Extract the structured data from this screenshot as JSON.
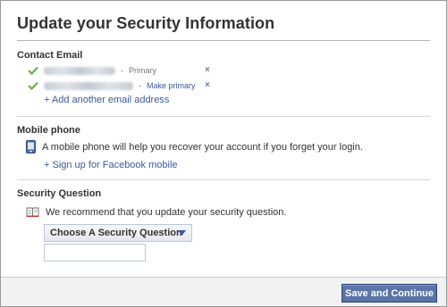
{
  "dialog": {
    "title": "Update your Security Information",
    "contact_email": {
      "heading": "Contact Email",
      "emails": [
        {
          "address_blurred": true,
          "separator": "-",
          "status": "Primary"
        },
        {
          "address_blurred": true,
          "separator": "-",
          "action": "Make primary"
        }
      ],
      "add_link": "+ Add another email address",
      "remove_symbol": "×"
    },
    "mobile_phone": {
      "heading": "Mobile phone",
      "info": "A mobile phone will help you recover your account if you forget your login.",
      "signup_link": "+ Sign up for Facebook mobile"
    },
    "security_question": {
      "heading": "Security Question",
      "info": "We recommend that you update your security question.",
      "dropdown_selected": "Choose A Security Question",
      "answer_value": ""
    },
    "footer": {
      "save_button": "Save and Continue"
    }
  },
  "colors": {
    "link": "#3b5998",
    "button_bg": "#5b74a8",
    "check": "#6ab04c",
    "footer_bg": "#f2f2f2"
  },
  "icons": [
    "check-icon",
    "remove-icon",
    "phone-icon",
    "book-icon",
    "chevron-down-icon"
  ]
}
